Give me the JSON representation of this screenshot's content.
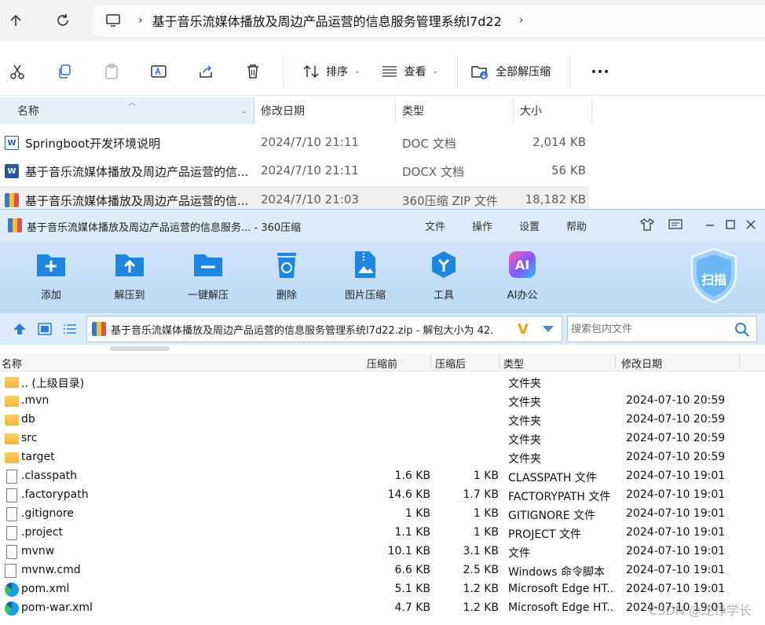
{
  "explorer": {
    "breadcrumb": "基于音乐流媒体播放及周边产品运营的信息服务管理系统l7d22",
    "toolbar": {
      "sort_label": "排序",
      "view_label": "查看",
      "extract_all_label": "全部解压缩"
    },
    "columns": {
      "name": "名称",
      "date": "修改日期",
      "type": "类型",
      "size": "大小"
    },
    "rows": [
      {
        "name": "Springboot开发环境说明",
        "date": "2024/7/10 21:11",
        "type": "DOC 文档",
        "size": "2,014 KB"
      },
      {
        "name": "基于音乐流媒体播放及周边产品运营的信...",
        "date": "2024/7/10 21:11",
        "type": "DOCX 文档",
        "size": "56 KB"
      },
      {
        "name": "基于音乐流媒体播放及周边产品运营的信...",
        "date": "2024/7/10 21:03",
        "type": "360压缩 ZIP 文件",
        "size": "18,182 KB"
      }
    ]
  },
  "zip": {
    "title": "基于音乐流媒体播放及周边产品运营的信息服务... - 360压缩",
    "menu": [
      "文件",
      "操作",
      "设置",
      "帮助"
    ],
    "tools": [
      "添加",
      "解压到",
      "一键解压",
      "删除",
      "图片压缩",
      "工具",
      "AI办公"
    ],
    "ai_badge": "AI",
    "scan_label": "扫描",
    "path": "基于音乐流媒体播放及周边产品运营的信息服务管理系统l7d22.zip - 解包大小为 42.",
    "search_placeholder": "搜索包内文件",
    "columns": {
      "name": "名称",
      "before": "压缩前",
      "after": "压缩后",
      "type": "类型",
      "date": "修改日期"
    },
    "rows": [
      {
        "name": ".. (上级目录)",
        "before": "",
        "after": "",
        "type": "文件夹",
        "date": "",
        "icon": "folder-icon"
      },
      {
        "name": ".mvn",
        "before": "",
        "after": "",
        "type": "文件夹",
        "date": "2024-07-10 20:59",
        "icon": "folder-icon"
      },
      {
        "name": "db",
        "before": "",
        "after": "",
        "type": "文件夹",
        "date": "2024-07-10 20:59",
        "icon": "folder-icon"
      },
      {
        "name": "src",
        "before": "",
        "after": "",
        "type": "文件夹",
        "date": "2024-07-10 20:59",
        "icon": "folder-icon"
      },
      {
        "name": "target",
        "before": "",
        "after": "",
        "type": "文件夹",
        "date": "2024-07-10 20:59",
        "icon": "folder-icon"
      },
      {
        "name": ".classpath",
        "before": "1.6 KB",
        "after": "1 KB",
        "type": "CLASSPATH 文件",
        "date": "2024-07-10 19:01",
        "icon": "file-icon"
      },
      {
        "name": ".factorypath",
        "before": "14.6 KB",
        "after": "1.7 KB",
        "type": "FACTORYPATH 文件",
        "date": "2024-07-10 19:01",
        "icon": "file-icon"
      },
      {
        "name": ".gitignore",
        "before": "1 KB",
        "after": "1 KB",
        "type": "GITIGNORE 文件",
        "date": "2024-07-10 19:01",
        "icon": "file-icon"
      },
      {
        "name": ".project",
        "before": "1.1 KB",
        "after": "1 KB",
        "type": "PROJECT 文件",
        "date": "2024-07-10 19:01",
        "icon": "file-icon"
      },
      {
        "name": "mvnw",
        "before": "10.1 KB",
        "after": "3.1 KB",
        "type": "文件",
        "date": "2024-07-10 19:01",
        "icon": "file-icon"
      },
      {
        "name": "mvnw.cmd",
        "before": "6.6 KB",
        "after": "2.5 KB",
        "type": "Windows 命令脚本",
        "date": "2024-07-10 19:01",
        "icon": "cmd-icon"
      },
      {
        "name": "pom.xml",
        "before": "5.1 KB",
        "after": "1.2 KB",
        "type": "Microsoft Edge HT...",
        "date": "2024-07-10 19:01",
        "icon": "edge-icon"
      },
      {
        "name": "pom-war.xml",
        "before": "4.7 KB",
        "after": "1.2 KB",
        "type": "Microsoft Edge HT...",
        "date": "2024-07-10 19:01",
        "icon": "edge-icon"
      }
    ]
  },
  "watermark": "CSDN @龙铮学长"
}
